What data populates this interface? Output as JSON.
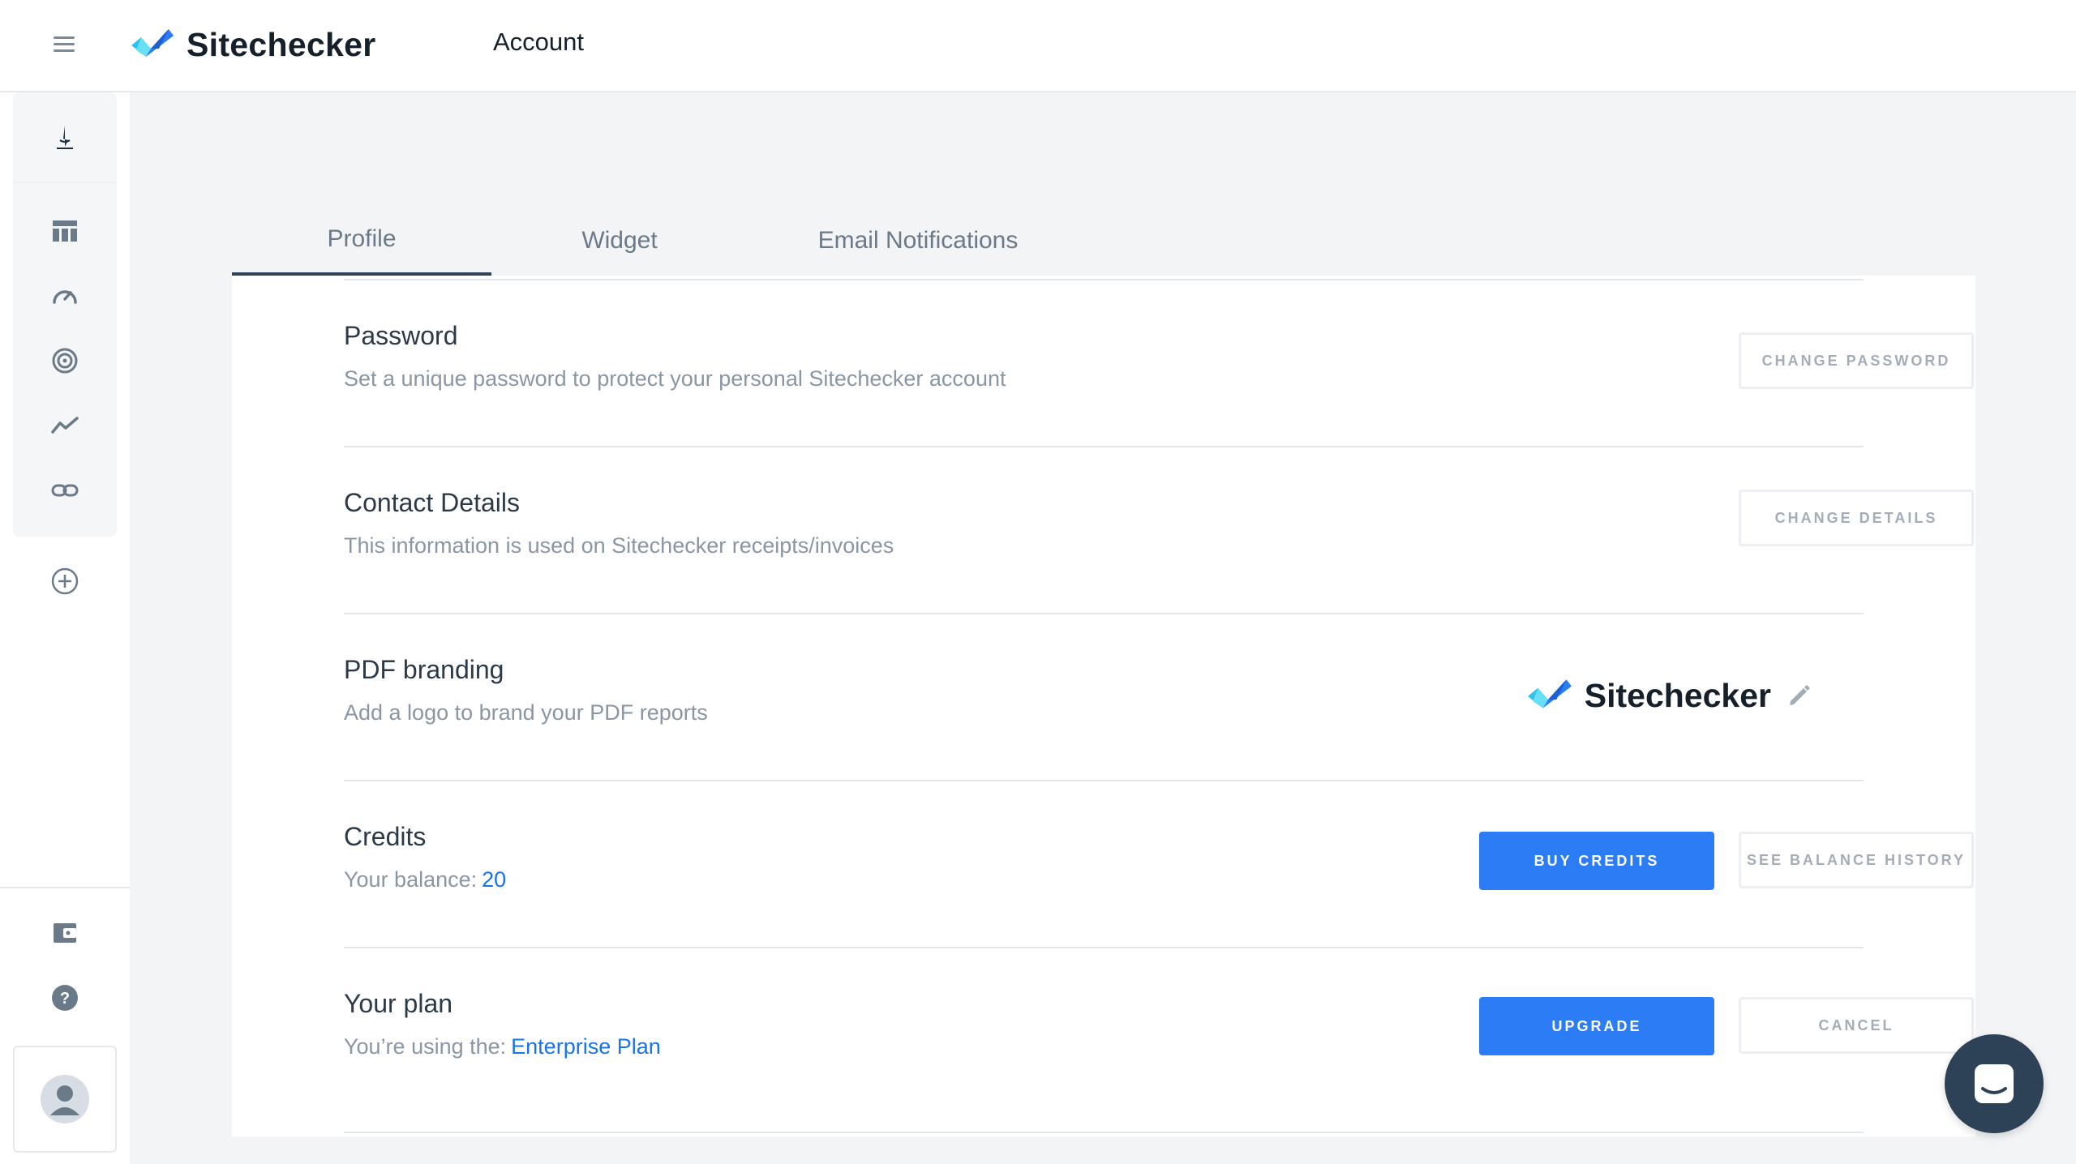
{
  "app": {
    "brand": "Sitechecker",
    "page_title": "Account"
  },
  "sidebar": {
    "icons": [
      "project-logo-icon",
      "dashboard-icon",
      "speed-gauge-icon",
      "target-icon",
      "trend-icon",
      "link-icon",
      "add-icon",
      "wallet-icon",
      "help-icon",
      "user-avatar-icon"
    ]
  },
  "tabs": [
    {
      "label": "Profile",
      "active": true
    },
    {
      "label": "Widget",
      "active": false
    },
    {
      "label": "Email Notifications",
      "active": false
    }
  ],
  "sections": {
    "password": {
      "title": "Password",
      "description": "Set a unique password to protect your personal Sitechecker account",
      "button": "CHANGE PASSWORD"
    },
    "contact": {
      "title": "Contact Details",
      "description": "This information is used on Sitechecker receipts/invoices",
      "button": "CHANGE DETAILS"
    },
    "pdf": {
      "title": "PDF branding",
      "description": "Add a logo to brand your PDF reports",
      "logo_text": "Sitechecker"
    },
    "credits": {
      "title": "Credits",
      "balance_label": "Your balance:",
      "balance_value": "20",
      "primary_button": "BUY CREDITS",
      "secondary_button": "SEE BALANCE HISTORY"
    },
    "plan": {
      "title": "Your plan",
      "plan_label": "You’re using the:",
      "plan_value": "Enterprise Plan",
      "primary_button": "UPGRADE",
      "secondary_button": "CANCEL"
    }
  },
  "colors": {
    "primary": "#2c7cf6",
    "link": "#1a73e8",
    "brand_dark": "#15202b",
    "tab_indicator": "#2f4256",
    "chat_bubble": "#2d4257"
  }
}
